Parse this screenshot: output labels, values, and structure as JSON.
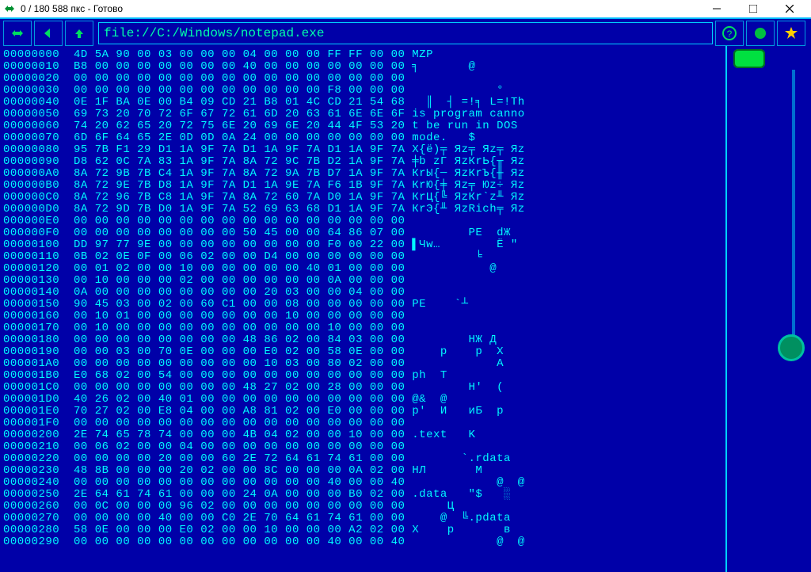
{
  "titlebar": {
    "text": "0 / 180 588 пкс - Готово"
  },
  "toolbar": {
    "address": "file://C:/Windows/notepad.exe"
  },
  "hex_rows": [
    "00000000  4D 5A 90 00 03 00 00 00 04 00 00 00 FF FF 00 00 MZР             ",
    "00000010  B8 00 00 00 00 00 00 00 40 00 00 00 00 00 00 00 ╕       @       ",
    "00000020  00 00 00 00 00 00 00 00 00 00 00 00 00 00 00 00                 ",
    "00000030  00 00 00 00 00 00 00 00 00 00 00 00 F8 00 00 00             °   ",
    "00000040  0E 1F BA 0E 00 B4 09 CD 21 B8 01 4C CD 21 54 68   ║  ┤ =!╕ L=!Th",
    "00000050  69 73 20 70 72 6F 67 72 61 6D 20 63 61 6E 6E 6F is program canno",
    "00000060  74 20 62 65 20 72 75 6E 20 69 6E 20 44 4F 53 20 t be run in DOS ",
    "00000070  6D 6F 64 65 2E 0D 0D 0A 24 00 00 00 00 00 00 00 mode.   $       ",
    "00000080  95 7B F1 29 D1 1A 9F 7A D1 1A 9F 7A D1 1A 9F 7A Х{ё)╤ Яz╤ Яz╤ Яz",
    "00000090  D8 62 0C 7A 83 1A 9F 7A 8A 72 9C 7B D2 1A 9F 7A ╪b zГ ЯzКrЬ{╥ Яz",
    "000000A0  8A 72 9B 7B C4 1A 9F 7A 8A 72 9A 7B D7 1A 9F 7A КrЫ{─ ЯzКrЪ{╫ Яz",
    "000000B0  8A 72 9E 7B D8 1A 9F 7A D1 1A 9E 7A F6 1B 9F 7A КrЮ{╪ Яz╤ Юz÷ Яz",
    "000000C0  8A 72 96 7B C8 1A 9F 7A 8A 72 60 7A D0 1A 9F 7A КrЦ{╚ ЯzКr`z╨ Яz",
    "000000D0  8A 72 9D 7B D0 1A 9F 7A 52 69 63 68 D1 1A 9F 7A КrЭ{╨ ЯzRich╤ Яz",
    "000000E0  00 00 00 00 00 00 00 00 00 00 00 00 00 00 00 00                 ",
    "000000F0  00 00 00 00 00 00 00 00 50 45 00 00 64 86 07 00         PE  dЖ  ",
    "00000100  DD 97 77 9E 00 00 00 00 00 00 00 00 F0 00 22 00 ▌Чw…        Ё \" ",
    "00000110  0B 02 0E 0F 00 06 02 00 00 D4 00 00 00 00 00 00          ╘      ",
    "00000120  00 01 02 00 00 10 00 00 00 00 00 40 01 00 00 00            @    ",
    "00000130  00 10 00 00 00 02 00 00 00 00 00 00 0A 00 00 00                 ",
    "00000140  0A 00 00 00 00 00 00 00 00 20 03 00 00 04 00 00                 ",
    "00000150  90 45 03 00 02 00 60 C1 00 00 08 00 00 00 00 00 РE    `┴        ",
    "00000160  00 10 01 00 00 00 00 00 00 00 10 00 00 00 00 00                 ",
    "00000170  00 10 00 00 00 00 00 00 00 00 00 00 10 00 00 00                 ",
    "00000180  00 00 00 00 00 00 00 00 48 86 02 00 84 03 00 00         HЖ Д   ",
    "00000190  00 00 03 00 70 0E 00 00 00 E0 02 00 58 0E 00 00     p    р  X   ",
    "000001A0  00 00 00 00 00 00 00 00 00 10 03 00 80 02 00 00             A   ",
    "000001B0  E0 68 02 00 54 00 00 00 00 00 00 00 00 00 00 00 ph  T           ",
    "000001C0  00 00 00 00 00 00 00 00 48 27 02 00 28 00 00 00         H'  (   ",
    "000001D0  40 26 02 00 40 01 00 00 00 00 00 00 00 00 00 00 @&  @           ",
    "000001E0  70 27 02 00 E8 04 00 00 A8 81 02 00 E0 00 00 00 p'  И   иБ  р   ",
    "000001F0  00 00 00 00 00 00 00 00 00 00 00 00 00 00 00 00                 ",
    "00000200  2E 74 65 78 74 00 00 00 4B 04 02 00 00 10 00 00 .text   K       ",
    "00000210  00 06 02 00 00 04 00 00 00 00 00 00 00 00 00 00                 ",
    "00000220  00 00 00 00 20 00 00 60 2E 72 64 61 74 61 00 00        `.rdata  ",
    "00000230  48 8B 00 00 00 20 02 00 00 8C 00 00 00 0A 02 00 HЛ       М      ",
    "00000240  00 00 00 00 00 00 00 00 00 00 00 00 40 00 00 40             @  @",
    "00000250  2E 64 61 74 61 00 00 00 24 0A 00 00 00 B0 02 00 .data   \"$   ░  ",
    "00000260  00 0C 00 00 00 96 02 00 00 00 00 00 00 00 00 00      Ц          ",
    "00000270  00 00 00 00 40 00 00 C0 2E 70 64 61 74 61 00 00     @  ╚.pdata  ",
    "00000280  58 0E 00 00 00 E0 02 00 00 10 00 00 00 A2 02 00 X    р       в  ",
    "00000290  00 00 00 00 00 00 00 00 00 00 00 00 40 00 00 40             @  @"
  ]
}
